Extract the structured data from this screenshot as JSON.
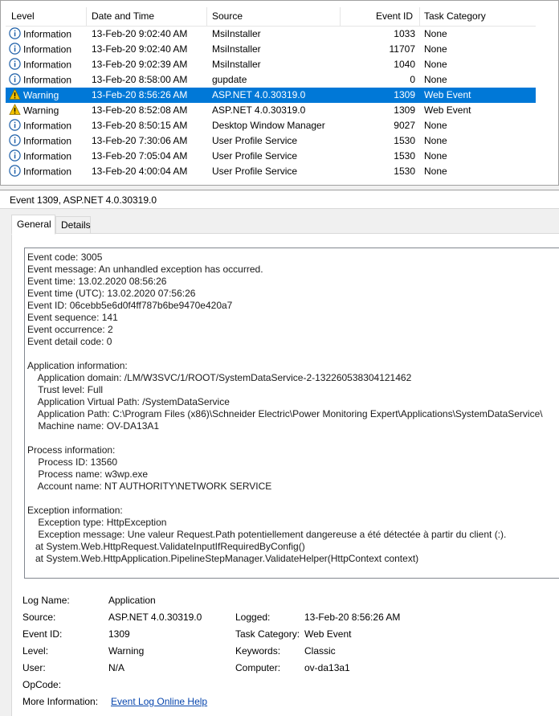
{
  "list": {
    "columns": [
      "Level",
      "Date and Time",
      "Source",
      "Event ID",
      "Task Category"
    ],
    "rows": [
      {
        "level": "Information",
        "date": "13-Feb-20 9:02:40 AM",
        "source": "MsiInstaller",
        "id": "1033",
        "category": "None"
      },
      {
        "level": "Information",
        "date": "13-Feb-20 9:02:40 AM",
        "source": "MsiInstaller",
        "id": "11707",
        "category": "None"
      },
      {
        "level": "Information",
        "date": "13-Feb-20 9:02:39 AM",
        "source": "MsiInstaller",
        "id": "1040",
        "category": "None"
      },
      {
        "level": "Information",
        "date": "13-Feb-20 8:58:00 AM",
        "source": "gupdate",
        "id": "0",
        "category": "None"
      },
      {
        "level": "Warning",
        "date": "13-Feb-20 8:56:26 AM",
        "source": "ASP.NET 4.0.30319.0",
        "id": "1309",
        "category": "Web Event",
        "selected": true
      },
      {
        "level": "Warning",
        "date": "13-Feb-20 8:52:08 AM",
        "source": "ASP.NET 4.0.30319.0",
        "id": "1309",
        "category": "Web Event"
      },
      {
        "level": "Information",
        "date": "13-Feb-20 8:50:15 AM",
        "source": "Desktop Window Manager",
        "id": "9027",
        "category": "None"
      },
      {
        "level": "Information",
        "date": "13-Feb-20 7:30:06 AM",
        "source": "User Profile Service",
        "id": "1530",
        "category": "None"
      },
      {
        "level": "Information",
        "date": "13-Feb-20 7:05:04 AM",
        "source": "User Profile Service",
        "id": "1530",
        "category": "None"
      },
      {
        "level": "Information",
        "date": "13-Feb-20 4:00:04 AM",
        "source": "User Profile Service",
        "id": "1530",
        "category": "None"
      }
    ],
    "icons": {
      "Information": "info-icon",
      "Warning": "warning-icon"
    },
    "colors": {
      "selected": "#0078d7",
      "info": "#1d5fa8",
      "warning": "#f2c200"
    }
  },
  "detail": {
    "title": "Event 1309, ASP.NET 4.0.30319.0",
    "tabs": [
      "General",
      "Details"
    ],
    "message_lines": [
      "Event code: 3005",
      "Event message: An unhandled exception has occurred.",
      "Event time: 13.02.2020 08:56:26",
      "Event time (UTC): 13.02.2020 07:56:26",
      "Event ID: 06cebb5e6d0f4ff787b6be9470e420a7",
      "Event sequence: 141",
      "Event occurrence: 2",
      "Event detail code: 0",
      "",
      "Application information:",
      "    Application domain: /LM/W3SVC/1/ROOT/SystemDataService-2-132260538304121462",
      "    Trust level: Full",
      "    Application Virtual Path: /SystemDataService",
      "    Application Path: C:\\Program Files (x86)\\Schneider Electric\\Power Monitoring Expert\\Applications\\SystemDataService\\",
      "    Machine name: OV-DA13A1",
      "",
      "Process information:",
      "    Process ID: 13560",
      "    Process name: w3wp.exe",
      "    Account name: NT AUTHORITY\\NETWORK SERVICE",
      "",
      "Exception information:",
      "    Exception type: HttpException",
      "    Exception message: Une valeur Request.Path potentiellement dangereuse a été détectée à partir du client (:).",
      "   at System.Web.HttpRequest.ValidateInputIfRequiredByConfig()",
      "   at System.Web.HttpApplication.PipelineStepManager.ValidateHelper(HttpContext context)"
    ],
    "meta": {
      "log_name_label": "Log Name:",
      "log_name": "Application",
      "source_label": "Source:",
      "source": "ASP.NET 4.0.30319.0",
      "logged_label": "Logged:",
      "logged": "13-Feb-20 8:56:26 AM",
      "event_id_label": "Event ID:",
      "event_id": "1309",
      "task_category_label": "Task Category:",
      "task_category": "Web Event",
      "level_label": "Level:",
      "level": "Warning",
      "keywords_label": "Keywords:",
      "keywords": "Classic",
      "user_label": "User:",
      "user": "N/A",
      "computer_label": "Computer:",
      "computer": "ov-da13a1",
      "opcode_label": "OpCode:",
      "more_info_label": "More Information:",
      "more_info_link": "Event Log Online Help"
    }
  }
}
